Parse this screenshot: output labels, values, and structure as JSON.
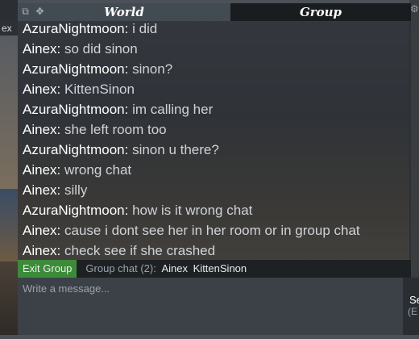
{
  "tabs": {
    "world_label": "World",
    "group_label": "Group"
  },
  "icons": {
    "toolbar": [
      "pop-out-icon",
      "move-icon"
    ],
    "settings": "gear-icon"
  },
  "background_label": "ex",
  "messages": [
    {
      "sender": "AzuraNightmoon",
      "text": "i did"
    },
    {
      "sender": "Ainex",
      "text": "so did sinon"
    },
    {
      "sender": "AzuraNightmoon",
      "text": "sinon?"
    },
    {
      "sender": "Ainex",
      "text": "KittenSinon"
    },
    {
      "sender": "AzuraNightmoon",
      "text": "im calling her"
    },
    {
      "sender": "Ainex",
      "text": "she left room too"
    },
    {
      "sender": "AzuraNightmoon",
      "text": "sinon u there?"
    },
    {
      "sender": "Ainex",
      "text": "wrong chat"
    },
    {
      "sender": "Ainex",
      "text": "silly"
    },
    {
      "sender": "AzuraNightmoon",
      "text": "how is it wrong chat"
    },
    {
      "sender": "Ainex",
      "text": "cause i dont see her in her room or in group chat"
    },
    {
      "sender": "Ainex",
      "text": "check see if she crashed"
    }
  ],
  "status": {
    "exit_label": "Exit Group",
    "group_label": "Group chat (2):",
    "members": [
      "Ainex",
      "KittenSinon"
    ]
  },
  "input": {
    "placeholder": "Write a message...",
    "value": ""
  },
  "send": {
    "label": "Se",
    "sublabel": "(E"
  },
  "colors": {
    "active_tab": "#1a1d20",
    "inactive_tab": "#424a52",
    "exit_button": "#3d8a3a",
    "message_text": "#cfd3d7"
  }
}
